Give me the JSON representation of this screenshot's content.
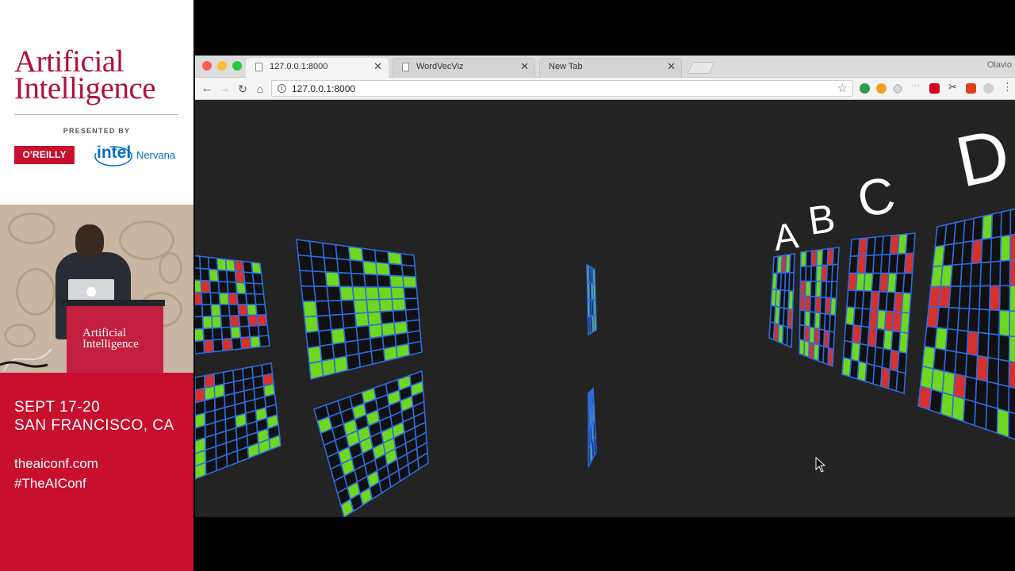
{
  "conference": {
    "title_line1": "Artificial",
    "title_line2": "Intelligence",
    "presented_by": "PRESENTED BY",
    "sponsor_oreilly": "O'REILLY",
    "sponsor_intel": "intel",
    "sponsor_nervana": "Nervana",
    "podium_line1": "Artificial",
    "podium_line2": "Intelligence",
    "dates": "SEPT 17-20",
    "city": "SAN FRANCISCO, CA",
    "website": "theaiconf.com",
    "hashtag": "#TheAIConf",
    "brand_color": "#c8102e"
  },
  "browser": {
    "tabs": [
      {
        "label": "127.0.0.1:8000",
        "active": true
      },
      {
        "label": "WordVecViz",
        "active": false
      },
      {
        "label": "New Tab",
        "active": false
      }
    ],
    "profile_name": "Olavio",
    "url": "127.0.0.1:8000",
    "icons": [
      "back-icon",
      "forward-icon",
      "reload-icon",
      "home-icon",
      "info-icon",
      "star-icon"
    ]
  },
  "scene": {
    "letters": [
      "A",
      "B",
      "C",
      "D"
    ],
    "grid_colors": {
      "line": "#2d6be0",
      "green": "#6fd81e",
      "red": "#d8302a",
      "dark": "#111111"
    }
  }
}
